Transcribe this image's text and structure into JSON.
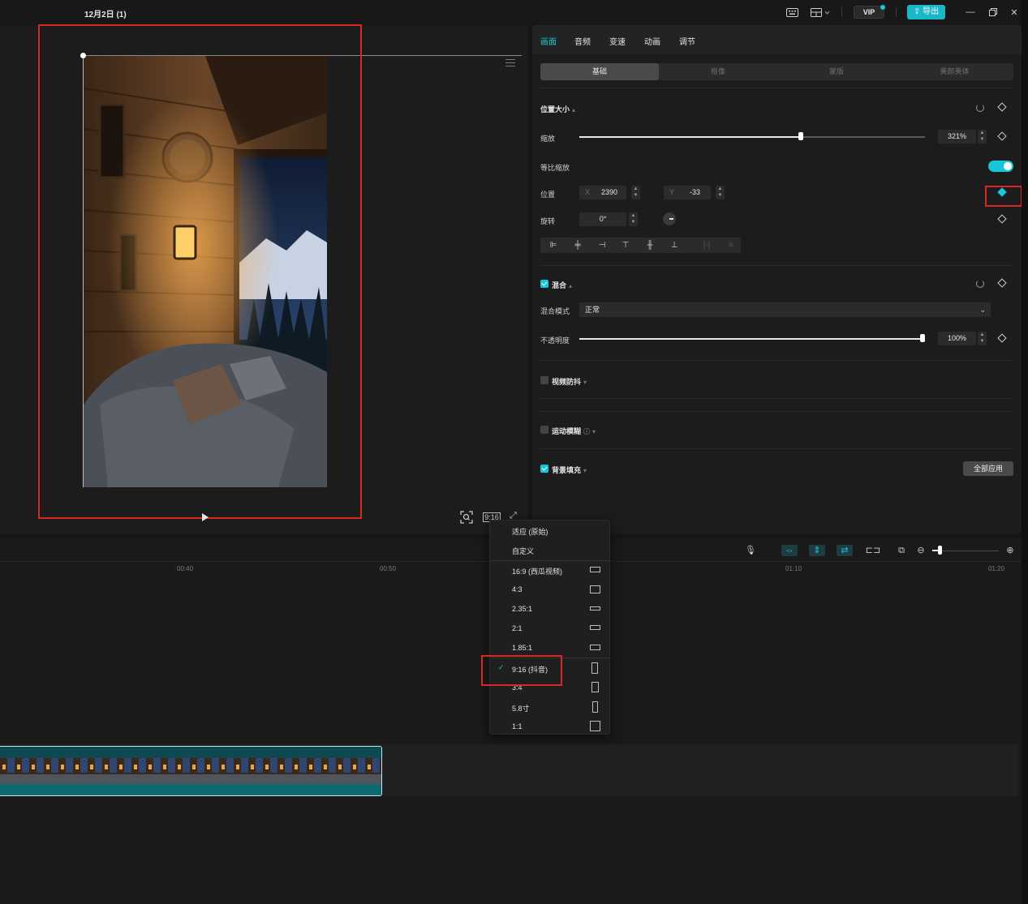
{
  "titlebar": {
    "project_title": "12月2日 (1)",
    "vip_label": "VIP",
    "export_label": "导出",
    "icons": [
      "keyboard-icon",
      "layout-icon",
      "minimize-icon",
      "restore-icon",
      "close-icon"
    ]
  },
  "player": {
    "ratio_label": "9:16"
  },
  "panel": {
    "tabs": [
      {
        "label": "画面",
        "active": true
      },
      {
        "label": "音频",
        "active": false
      },
      {
        "label": "变速",
        "active": false
      },
      {
        "label": "动画",
        "active": false
      },
      {
        "label": "调节",
        "active": false
      }
    ],
    "subtabs": [
      {
        "label": "基础",
        "active": true
      },
      {
        "label": "抠像",
        "active": false
      },
      {
        "label": "蒙版",
        "active": false
      },
      {
        "label": "美颜美体",
        "active": false
      }
    ],
    "position_size": {
      "title": "位置大小",
      "scale_label": "缩放",
      "scale_value": "321%",
      "scale_fraction": 0.64,
      "uniform_scale_label": "等比缩放",
      "uniform_scale_on": true,
      "position_label": "位置",
      "x_label": "X",
      "x_value": "2390",
      "y_label": "Y",
      "y_value": "-33",
      "rotate_label": "旋转",
      "rotate_value": "0°"
    },
    "blend": {
      "title": "混合",
      "checked": true,
      "mode_label": "混合模式",
      "mode_value": "正常",
      "opacity_label": "不透明度",
      "opacity_value": "100%",
      "opacity_fraction": 1.0
    },
    "stabilize": {
      "title": "视频防抖",
      "checked": false
    },
    "motion_blur": {
      "title": "运动模糊",
      "checked": false
    },
    "background_fill": {
      "title": "背景填充",
      "checked": true,
      "apply_all_label": "全部应用"
    }
  },
  "timeline": {
    "ruler_labels": [
      "00:40",
      "00:50",
      "01:10",
      "01:20"
    ]
  },
  "ratio_menu": {
    "items": [
      {
        "label": "适应 (原始)",
        "selected": false
      },
      {
        "label": "自定义",
        "selected": false
      },
      {
        "label": "16:9 (西瓜视频)",
        "selected": false
      },
      {
        "label": "4:3",
        "selected": false
      },
      {
        "label": "2.35:1",
        "selected": false
      },
      {
        "label": "2:1",
        "selected": false
      },
      {
        "label": "1.85:1",
        "selected": false
      },
      {
        "label": "9:16 (抖音)",
        "selected": true
      },
      {
        "label": "3:4",
        "selected": false
      },
      {
        "label": "5.8寸",
        "selected": false
      },
      {
        "label": "1:1",
        "selected": false
      }
    ]
  },
  "colors": {
    "accent": "#17c6d8",
    "highlight": "#d8281f"
  }
}
